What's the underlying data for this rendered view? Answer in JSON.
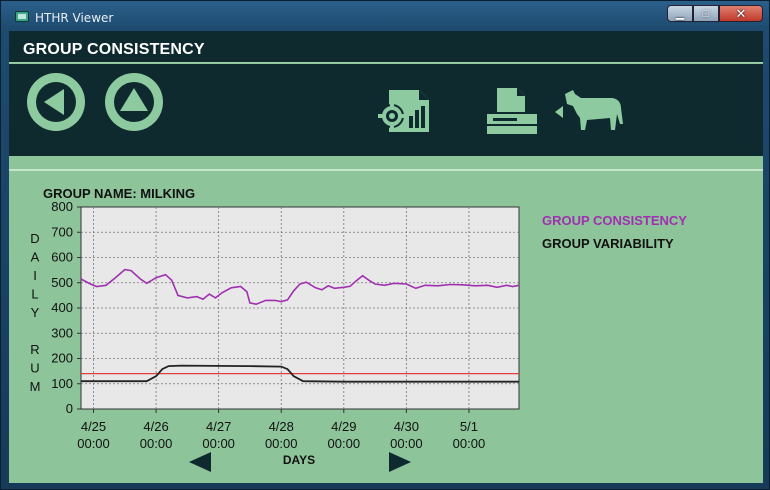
{
  "window": {
    "title": "HTHR Viewer",
    "minimize_glyph": "▁",
    "maximize_glyph": "□",
    "close_glyph": "✕"
  },
  "header": {
    "title": "GROUP CONSISTENCY"
  },
  "toolbar": {
    "icons": [
      "back-icon",
      "up-icon",
      "report-settings-icon",
      "print-icon",
      "cow-icon"
    ]
  },
  "chart_data": {
    "type": "line",
    "title": "GROUP NAME: MILKING",
    "xlabel": "DAYS",
    "ylabel": "DAILY RUM",
    "ylabel_letters": [
      "D",
      "A",
      "I",
      "L",
      "Y",
      "",
      "R",
      "U",
      "M"
    ],
    "ylim": [
      0,
      800
    ],
    "yticks": [
      "800",
      "700",
      "600",
      "500",
      "400",
      "300",
      "200",
      "100",
      "0"
    ],
    "xticks": [
      {
        "day": "4/25",
        "time": "00:00"
      },
      {
        "day": "4/26",
        "time": "00:00"
      },
      {
        "day": "4/27",
        "time": "00:00"
      },
      {
        "day": "4/28",
        "time": "00:00"
      },
      {
        "day": "4/29",
        "time": "00:00"
      },
      {
        "day": "4/30",
        "time": "00:00"
      },
      {
        "day": "5/1",
        "time": "00:00"
      }
    ],
    "xrange_days": [
      4.8,
      11.8
    ],
    "grid": true,
    "legend_position": "right",
    "series": [
      {
        "name": "GROUP CONSISTENCY",
        "color": "#a030b0",
        "points": [
          [
            4.8,
            515
          ],
          [
            4.95,
            495
          ],
          [
            5.05,
            485
          ],
          [
            5.2,
            490
          ],
          [
            5.35,
            520
          ],
          [
            5.5,
            552
          ],
          [
            5.6,
            548
          ],
          [
            5.75,
            515
          ],
          [
            5.85,
            498
          ],
          [
            6.0,
            520
          ],
          [
            6.15,
            532
          ],
          [
            6.25,
            510
          ],
          [
            6.35,
            450
          ],
          [
            6.5,
            440
          ],
          [
            6.65,
            445
          ],
          [
            6.75,
            435
          ],
          [
            6.85,
            455
          ],
          [
            6.95,
            440
          ],
          [
            7.05,
            460
          ],
          [
            7.2,
            480
          ],
          [
            7.35,
            485
          ],
          [
            7.45,
            465
          ],
          [
            7.5,
            420
          ],
          [
            7.6,
            415
          ],
          [
            7.75,
            430
          ],
          [
            7.9,
            430
          ],
          [
            8.0,
            425
          ],
          [
            8.1,
            432
          ],
          [
            8.2,
            468
          ],
          [
            8.3,
            495
          ],
          [
            8.4,
            502
          ],
          [
            8.55,
            480
          ],
          [
            8.65,
            472
          ],
          [
            8.75,
            488
          ],
          [
            8.85,
            478
          ],
          [
            9.0,
            482
          ],
          [
            9.1,
            486
          ],
          [
            9.2,
            508
          ],
          [
            9.3,
            528
          ],
          [
            9.4,
            510
          ],
          [
            9.5,
            495
          ],
          [
            9.65,
            490
          ],
          [
            9.8,
            498
          ],
          [
            10.0,
            495
          ],
          [
            10.15,
            478
          ],
          [
            10.3,
            490
          ],
          [
            10.5,
            488
          ],
          [
            10.7,
            493
          ],
          [
            10.9,
            492
          ],
          [
            11.1,
            488
          ],
          [
            11.3,
            490
          ],
          [
            11.45,
            482
          ],
          [
            11.6,
            490
          ],
          [
            11.7,
            485
          ],
          [
            11.8,
            490
          ]
        ]
      },
      {
        "name": "GROUP VARIABILITY",
        "color": "#222222",
        "points": [
          [
            4.8,
            110
          ],
          [
            5.6,
            110
          ],
          [
            5.85,
            110
          ],
          [
            6.0,
            130
          ],
          [
            6.1,
            158
          ],
          [
            6.2,
            170
          ],
          [
            6.4,
            172
          ],
          [
            7.5,
            170
          ],
          [
            8.0,
            168
          ],
          [
            8.1,
            158
          ],
          [
            8.2,
            130
          ],
          [
            8.35,
            110
          ],
          [
            9.0,
            108
          ],
          [
            11.8,
            108
          ]
        ]
      }
    ],
    "reference_line": {
      "value": 140,
      "color": "#e04040"
    },
    "nav": {
      "left": "prev-range-icon",
      "right": "next-range-icon"
    }
  }
}
